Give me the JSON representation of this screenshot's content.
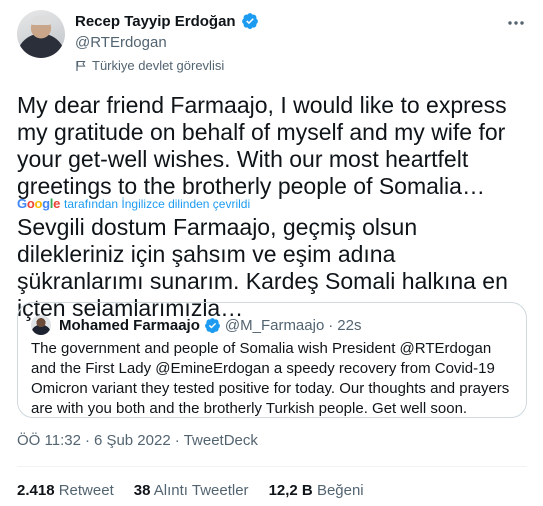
{
  "author": {
    "display_name": "Recep Tayyip Erdoğan",
    "handle": "@RTErdogan",
    "label": "Türkiye devlet görevlisi"
  },
  "tweet": {
    "translated_text": "My dear friend Farmaajo, I would like to express my gratitude on behalf of myself and my wife for your get-well wishes. With our most heartfelt greetings to the brotherly people of Somalia…",
    "translation_note": "tarafından İngilizce dilinden çevrildi",
    "google_letters": [
      "G",
      "o",
      "o",
      "g",
      "l",
      "e"
    ],
    "original_text": "Sevgili dostum Farmaajo, geçmiş olsun dilekleriniz için şahsım ve eşim adına şükranlarımı sunarım. Kardeş Somali halkına en içten selamlarımızla…"
  },
  "quote": {
    "display_name": "Mohamed Farmaajo",
    "handle": "@M_Farmaajo",
    "dot": "·",
    "time": "22s",
    "text": "The government and people of Somalia wish President @RTErdogan and the First Lady @EmineErdogan a speedy recovery from Covid-19 Omicron variant they tested positive for today. Our thoughts and prayers are with you both and the brotherly Turkish people. Get well soon."
  },
  "meta": {
    "time": "ÖÖ 11:32",
    "sep1": "·",
    "date": "6 Şub 2022",
    "sep2": "·",
    "source": "TweetDeck"
  },
  "stats": {
    "retweets_count": "2.418",
    "retweets_label": "Retweet",
    "quotes_count": "38",
    "quotes_label": "Alıntı Tweetler",
    "likes_count": "12,2 B",
    "likes_label": "Beğeni"
  },
  "colors": {
    "verified": "#1d9bf0",
    "link": "#1d9bf0",
    "secondary_text": "#536471"
  },
  "icons": {
    "verified": "verified-badge-icon",
    "label": "flag-icon",
    "more": "more-icon"
  }
}
